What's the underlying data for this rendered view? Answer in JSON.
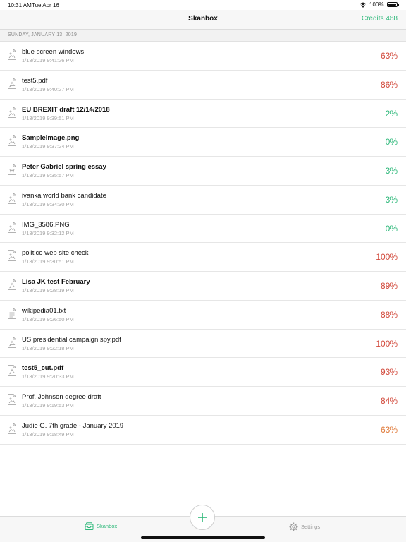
{
  "status_bar": {
    "time": "10:31 AM",
    "date": "Tue Apr 16",
    "battery": "100%"
  },
  "nav": {
    "title": "Skanbox",
    "credits": "Credits 468"
  },
  "section": {
    "header": "SUNDAY, JANUARY 13, 2019"
  },
  "colors": {
    "accent": "#2eb87a",
    "high": "#d24a3c",
    "mid": "#e07a3a",
    "low": "#2eb87a"
  },
  "documents": [
    {
      "name": "blue screen windows",
      "timestamp": "1/13/2019 9:41:26 PM",
      "percent": "63%",
      "bold": false,
      "icon": "image-file-icon",
      "level": "high"
    },
    {
      "name": "test5.pdf",
      "timestamp": "1/13/2019 9:40:27 PM",
      "percent": "86%",
      "bold": false,
      "icon": "pdf-file-icon",
      "level": "high"
    },
    {
      "name": "EU BREXIT draft 12/14/2018",
      "timestamp": "1/13/2019 9:39:51 PM",
      "percent": "2%",
      "bold": true,
      "icon": "image-file-icon",
      "level": "low"
    },
    {
      "name": "SampleImage.png",
      "timestamp": "1/13/2019 9:37:24 PM",
      "percent": "0%",
      "bold": true,
      "icon": "image-file-icon",
      "level": "low"
    },
    {
      "name": "Peter Gabriel spring essay",
      "timestamp": "1/13/2019 9:35:57 PM",
      "percent": "3%",
      "bold": true,
      "icon": "word-file-icon",
      "level": "low"
    },
    {
      "name": "ivanka world bank candidate",
      "timestamp": "1/13/2019 9:34:30 PM",
      "percent": "3%",
      "bold": false,
      "icon": "image-file-icon",
      "level": "low"
    },
    {
      "name": "IMG_3586.PNG",
      "timestamp": "1/13/2019 9:32:12 PM",
      "percent": "0%",
      "bold": false,
      "icon": "image-file-icon",
      "level": "low"
    },
    {
      "name": "politico web site check",
      "timestamp": "1/13/2019 9:30:51 PM",
      "percent": "100%",
      "bold": false,
      "icon": "image-file-icon",
      "level": "high"
    },
    {
      "name": "Lisa JK test February",
      "timestamp": "1/13/2019 9:28:19 PM",
      "percent": "89%",
      "bold": true,
      "icon": "pdf-file-icon",
      "level": "high"
    },
    {
      "name": "wikipedia01.txt",
      "timestamp": "1/13/2019 9:26:50 PM",
      "percent": "88%",
      "bold": false,
      "icon": "text-file-icon",
      "level": "high"
    },
    {
      "name": "US presidential campaign spy.pdf",
      "timestamp": "1/13/2019 9:22:18 PM",
      "percent": "100%",
      "bold": false,
      "icon": "pdf-file-icon",
      "level": "high"
    },
    {
      "name": "test5_cut.pdf",
      "timestamp": "1/13/2019 9:20:33 PM",
      "percent": "93%",
      "bold": true,
      "icon": "pdf-file-icon",
      "level": "high"
    },
    {
      "name": "Prof. Johnson degree draft",
      "timestamp": "1/13/2019 9:19:53 PM",
      "percent": "84%",
      "bold": false,
      "icon": "image-file-icon",
      "level": "high"
    },
    {
      "name": "Judie G. 7th grade - January 2019",
      "timestamp": "1/13/2019 9:18:49 PM",
      "percent": "63%",
      "bold": false,
      "icon": "image-file-icon",
      "level": "mid"
    }
  ],
  "tabbar": {
    "skanbox_label": "Skanbox",
    "settings_label": "Settings",
    "add_icon": "plus-icon"
  }
}
